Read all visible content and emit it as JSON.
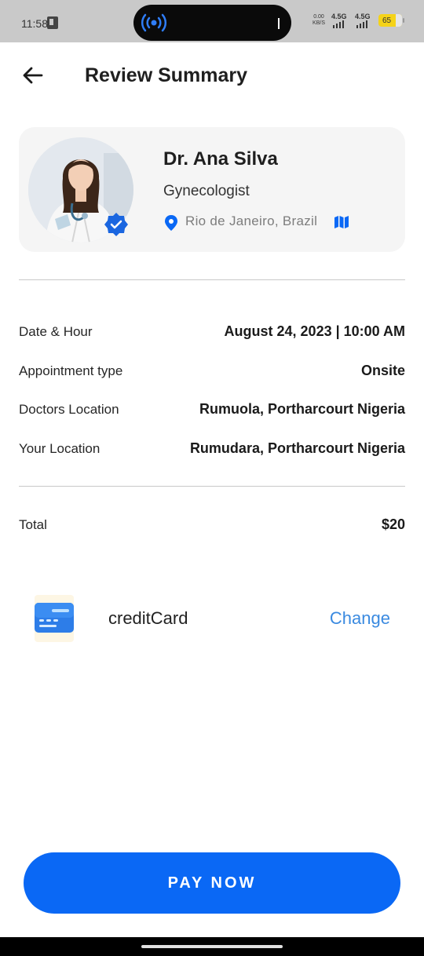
{
  "status_bar": {
    "time": "11:58",
    "net_speed_value": "0.00",
    "net_speed_unit": "KB/S",
    "signal_1": "4.5G",
    "signal_2": "4.5G",
    "battery": "65"
  },
  "header": {
    "title": "Review Summary"
  },
  "doctor": {
    "name": "Dr. Ana Silva",
    "specialty": "Gynecologist",
    "location": "Rio de Janeiro, Brazil"
  },
  "details": [
    {
      "label": "Date & Hour",
      "value": "August 24, 2023 | 10:00 AM"
    },
    {
      "label": "Appointment type",
      "value": "Onsite"
    },
    {
      "label": "Doctors Location",
      "value": "Rumuola, Portharcourt Nigeria"
    },
    {
      "label": "Your Location",
      "value": "Rumudara, Portharcourt Nigeria"
    }
  ],
  "total": {
    "label": "Total",
    "value": "$20"
  },
  "payment": {
    "method": "creditCard",
    "change_label": "Change"
  },
  "pay_button_label": "PAY NOW",
  "colors": {
    "primary": "#0a68f5",
    "link": "#3a8ae0",
    "card_bg": "#f5f5f5"
  }
}
